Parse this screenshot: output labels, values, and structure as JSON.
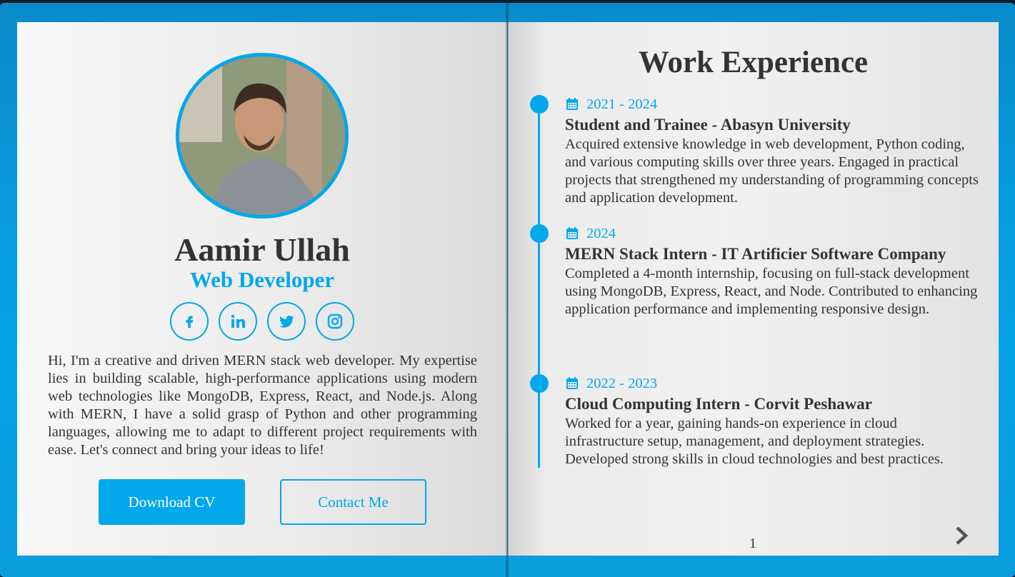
{
  "profile": {
    "name": "Aamir Ullah",
    "role": "Web Developer",
    "bio": "Hi, I'm a creative and driven MERN stack web developer. My expertise lies in building scalable, high-performance applications using modern web technologies like MongoDB, Express, React, and Node.js. Along with MERN, I have a solid grasp of Python and other programming languages, allowing me to adapt to different project requirements with ease. Let's connect and bring your ideas to life!",
    "socials": [
      {
        "icon": "facebook-icon",
        "glyph": "f"
      },
      {
        "icon": "linkedin-icon",
        "glyph": "in"
      },
      {
        "icon": "twitter-icon",
        "glyph": "t"
      },
      {
        "icon": "instagram-icon",
        "glyph": "ig"
      }
    ],
    "download_label": "Download CV",
    "contact_label": "Contact Me"
  },
  "work": {
    "title": "Work Experience",
    "entries": [
      {
        "date": "2021 - 2024",
        "title": "Student and Trainee - Abasyn University",
        "description": "Acquired extensive knowledge in web development, Python coding, and various computing skills over three years. Engaged in practical projects that strengthened my understanding of programming concepts and application development."
      },
      {
        "date": "2024",
        "title": "MERN Stack Intern - IT Artificier Software Company",
        "description": "Completed a 4-month internship, focusing on full-stack development using MongoDB, Express, React, and Node. Contributed to enhancing application performance and implementing responsive design."
      },
      {
        "date": "2022 - 2023",
        "title": "Cloud Computing Intern - Corvit Peshawar",
        "description": "Worked for a year, gaining hands-on experience in cloud infrastructure setup, management, and deployment strategies. Developed strong skills in cloud technologies and best practices."
      }
    ]
  },
  "page_number": "1",
  "colors": {
    "accent": "#03a7ec",
    "text": "#333333",
    "cover": "#05a5e8"
  }
}
